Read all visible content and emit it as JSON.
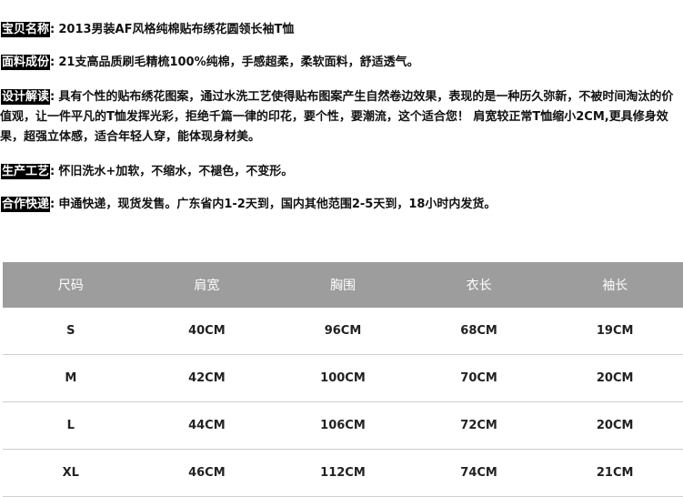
{
  "info": [
    {
      "label": "宝贝名称",
      "colon": ":",
      "text": "2013男装AF风格纯棉贴布绣花圆领长袖T恤"
    },
    {
      "label": "面料成份",
      "colon": ":",
      "text": "21支高品质刷毛精梳100%纯棉，手感超柔，柔软面料，舒适透气。"
    },
    {
      "label": "设计解读",
      "colon": ":",
      "text": "具有个性的贴布绣花图案，通过水洗工艺使得贴布图案产生自然卷边效果，表现的是一种历久弥新，不被时间淘汰的价值观，让一件平凡的T恤发挥光彩，拒绝千篇一律的印花，要个性，要潮流，这个适合您！ 肩宽较正常T恤缩小2CM,更具修身效果，超强立体感，适合年轻人穿，能体现身材美。"
    },
    {
      "label": "生产工艺",
      "colon": ":",
      "text": "怀旧洗水+加软，不缩水，不褪色，不变形。"
    },
    {
      "label": "合作快递",
      "colon": ":",
      "text": "申通快递，现货发售。广东省内1-2天到，国内其他范围2-5天到，18小时内发货。"
    }
  ],
  "size_table": {
    "headers": [
      "尺码",
      "肩宽",
      "胸围",
      "衣长",
      "袖长"
    ],
    "rows": [
      [
        "S",
        "40CM",
        "96CM",
        "68CM",
        "19CM"
      ],
      [
        "M",
        "42CM",
        "100CM",
        "70CM",
        "20CM"
      ],
      [
        "L",
        "44CM",
        "106CM",
        "72CM",
        "20CM"
      ],
      [
        "XL",
        "46CM",
        "112CM",
        "74CM",
        "21CM"
      ]
    ]
  }
}
